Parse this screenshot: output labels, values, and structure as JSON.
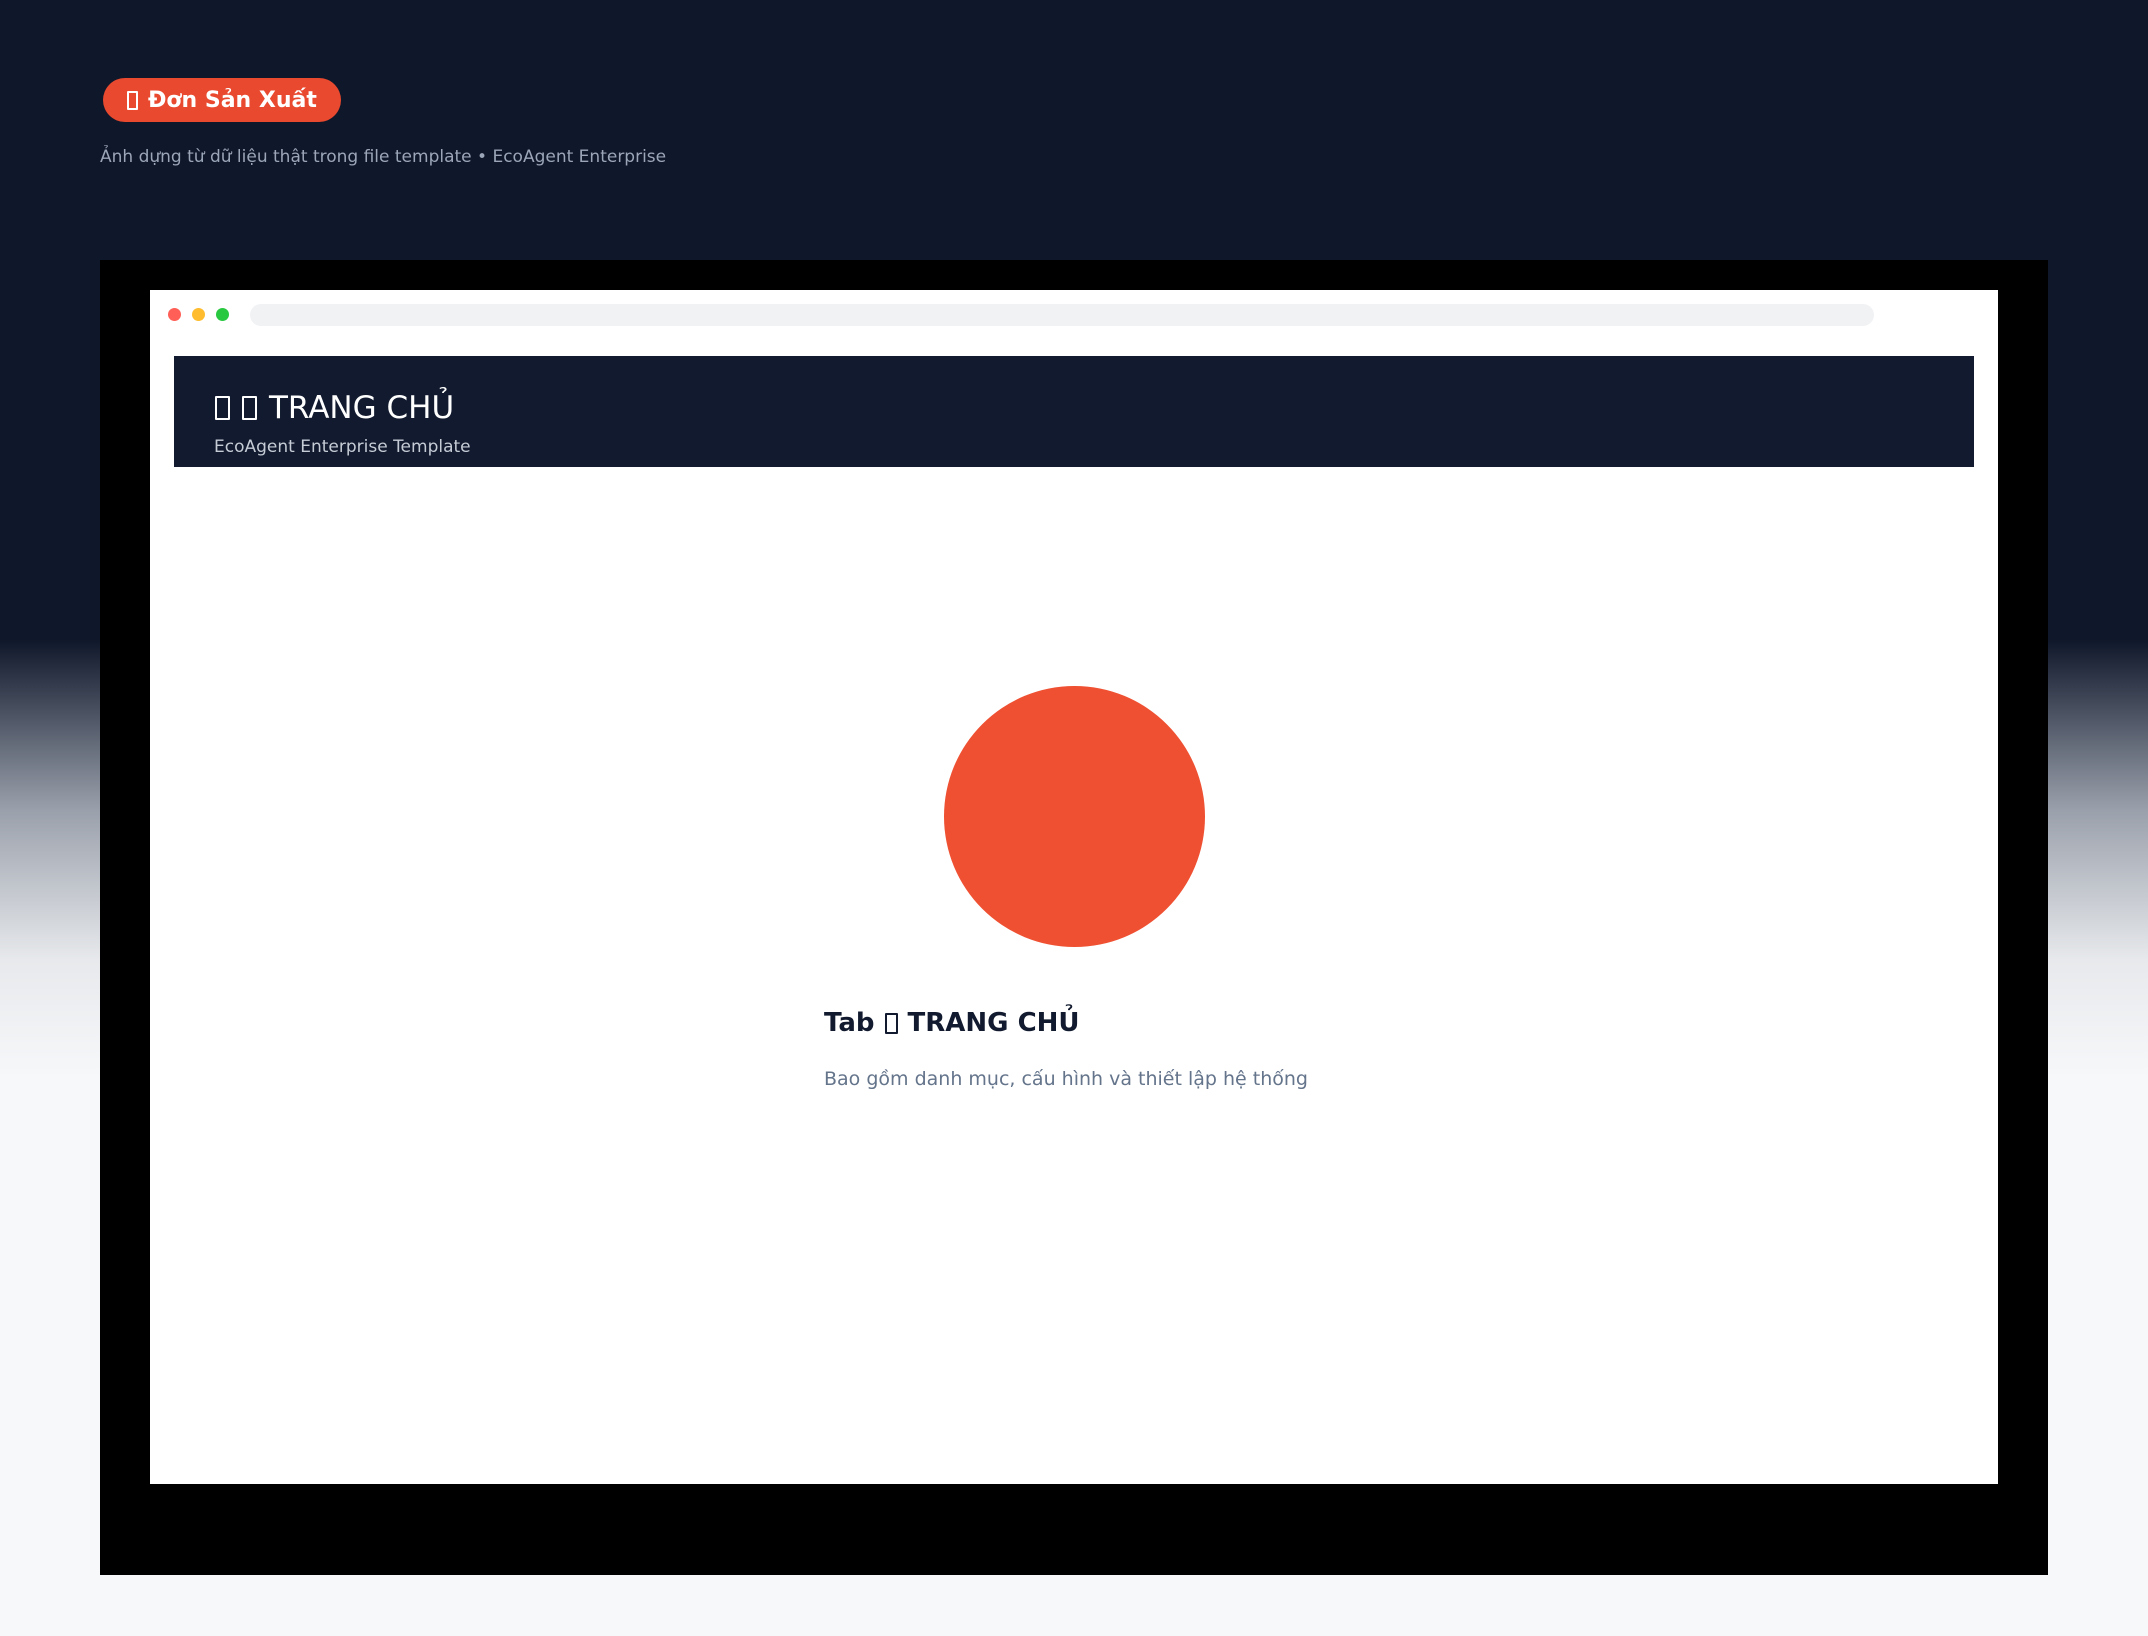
{
  "badge": {
    "label": "Đơn Sản Xuất",
    "color": "#e9492e"
  },
  "subtitle": "Ảnh dựng từ dữ liệu thật trong file template • EcoAgent Enterprise",
  "app": {
    "title": "TRANG CHỦ",
    "subtitle": "EcoAgent Enterprise Template",
    "header_color": "#111a2e"
  },
  "content": {
    "tab_prefix": "Tab",
    "tab_name": "TRANG CHỦ",
    "description": "Bao gồm danh mục, cấu hình và thiết lập hệ thống",
    "circle_color": "#ef5031"
  },
  "icons": {
    "badge_icon": "missing-glyph-icon",
    "header_icon_1": "missing-glyph-icon",
    "header_icon_2": "missing-glyph-icon",
    "tab_icon": "missing-glyph-icon"
  }
}
